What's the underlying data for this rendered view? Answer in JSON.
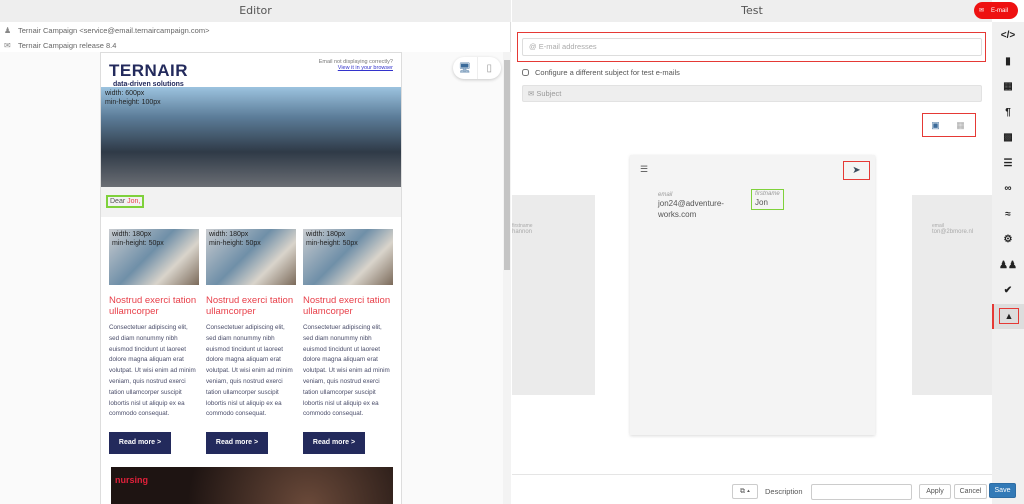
{
  "editor": {
    "title": "Editor",
    "sender": "Ternair Campaign <service@email.ternaircampaign.com>",
    "subject": "Ternair Campaign release 8.4",
    "email": {
      "logo_text": "TERNAIR",
      "logo_tagline": "data-driven solutions",
      "not_displaying": "Email not displaying correctly?",
      "view_in_browser": "View it in your browser",
      "hero_dims": [
        "width: 600px",
        "min-height: 100px"
      ],
      "greeting_prefix": "Dear ",
      "greeting_name": "Jon,",
      "columns": [
        {
          "dims": [
            "width: 180px",
            "min-height: 50px"
          ],
          "title": "Nostrud exerci tation ullamcorper",
          "body": "Consectetuer adipiscing elit, sed diam nonummy nibh euismod tincidunt ut laoreet dolore magna aliquam erat volutpat. Ut wisi enim ad minim veniam, quis nostrud exerci tation ullamcorper suscipit lobortis nisl ut aliquip ex ea commodo consequat.",
          "button": "Read more  >"
        },
        {
          "dims": [
            "width: 180px",
            "min-height: 50px"
          ],
          "title": "Nostrud exerci tation ullamcorper",
          "body": "Consectetuer adipiscing elit, sed diam nonummy nibh euismod tincidunt ut laoreet dolore magna aliquam erat volutpat. Ut wisi enim ad minim veniam, quis nostrud exerci tation ullamcorper suscipit lobortis nisl ut aliquip ex ea commodo consequat.",
          "button": "Read more  >"
        },
        {
          "dims": [
            "width: 180px",
            "min-height: 50px"
          ],
          "title": "Nostrud exerci tation ullamcorper",
          "body": "Consectetuer adipiscing elit, sed diam nonummy nibh euismod tincidunt ut laoreet dolore magna aliquam erat volutpat. Ut wisi enim ad minim veniam, quis nostrud exerci tation ullamcorper suscipit lobortis nisl ut aliquip ex ea commodo consequat.",
          "button": "Read more  >"
        }
      ],
      "banner_text": "nursing"
    }
  },
  "test": {
    "title": "Test",
    "email_placeholder": "E-mail addresses",
    "configure_label": "Configure a different subject for test e-mails",
    "subject_placeholder": "Subject",
    "card": {
      "fields": [
        {
          "label": "email",
          "value": "jon24@adventure-works.com"
        },
        {
          "label": "firstname",
          "value": "Jon"
        }
      ]
    },
    "left_card": {
      "label": "firstname",
      "value": "hannon"
    },
    "right_card": {
      "label": "email",
      "value": "ton@2bmore.nl"
    },
    "footer": {
      "description_label": "Description",
      "description_value": "",
      "apply": "Apply",
      "cancel": "Cancel",
      "save": "Save"
    }
  },
  "badge": {
    "label": "E-mail"
  },
  "colors": {
    "accent_red": "#e53935",
    "highlight_green": "#7fd13b",
    "navy": "#232a5c",
    "save_blue": "#337ab7"
  }
}
